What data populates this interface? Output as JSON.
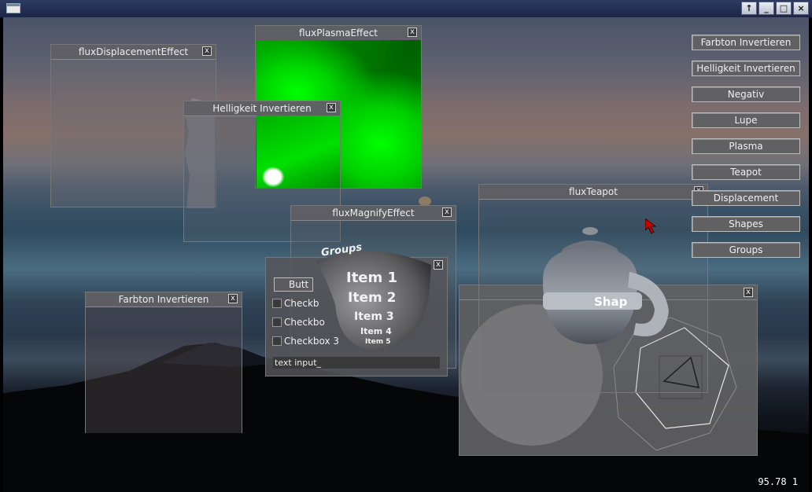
{
  "windows": {
    "displacement": {
      "title": "fluxDisplacementEffect",
      "close": "x"
    },
    "plasma": {
      "title": "fluxPlasmaEffect",
      "close": "x"
    },
    "helligkeit": {
      "title": "Helligkeit  Invertieren",
      "close": "x"
    },
    "magnify": {
      "title": "fluxMagnifyEffect",
      "close": "x"
    },
    "farbton": {
      "title": "Farbton  Invertieren",
      "close": "x"
    },
    "teapot": {
      "title": "fluxTeapot",
      "close": "x"
    },
    "groups_panel": {
      "close": "x",
      "button_label": "Butt",
      "checkboxes": [
        "Checkb",
        "Checkbo",
        "Checkbox  3"
      ],
      "text_input_value": "text  input_"
    },
    "shapes_panel": {
      "close": "x"
    }
  },
  "sidebar_buttons": [
    "Farbton  Invertieren",
    "Helligkeit  Invertieren",
    "Negativ",
    "Lupe",
    "Plasma",
    "Teapot",
    "Displacement",
    "Shapes",
    "Groups"
  ],
  "groups_sphere": {
    "title": "Groups",
    "items": [
      "Item 1",
      "Item 2",
      "Item 3",
      "Item 4",
      "Item 5"
    ]
  },
  "teapot_label": "Shap",
  "status": {
    "fps": "95.78  1"
  },
  "colors": {
    "plasma_green": "#00ff00",
    "accent_red": "#cc0000"
  }
}
